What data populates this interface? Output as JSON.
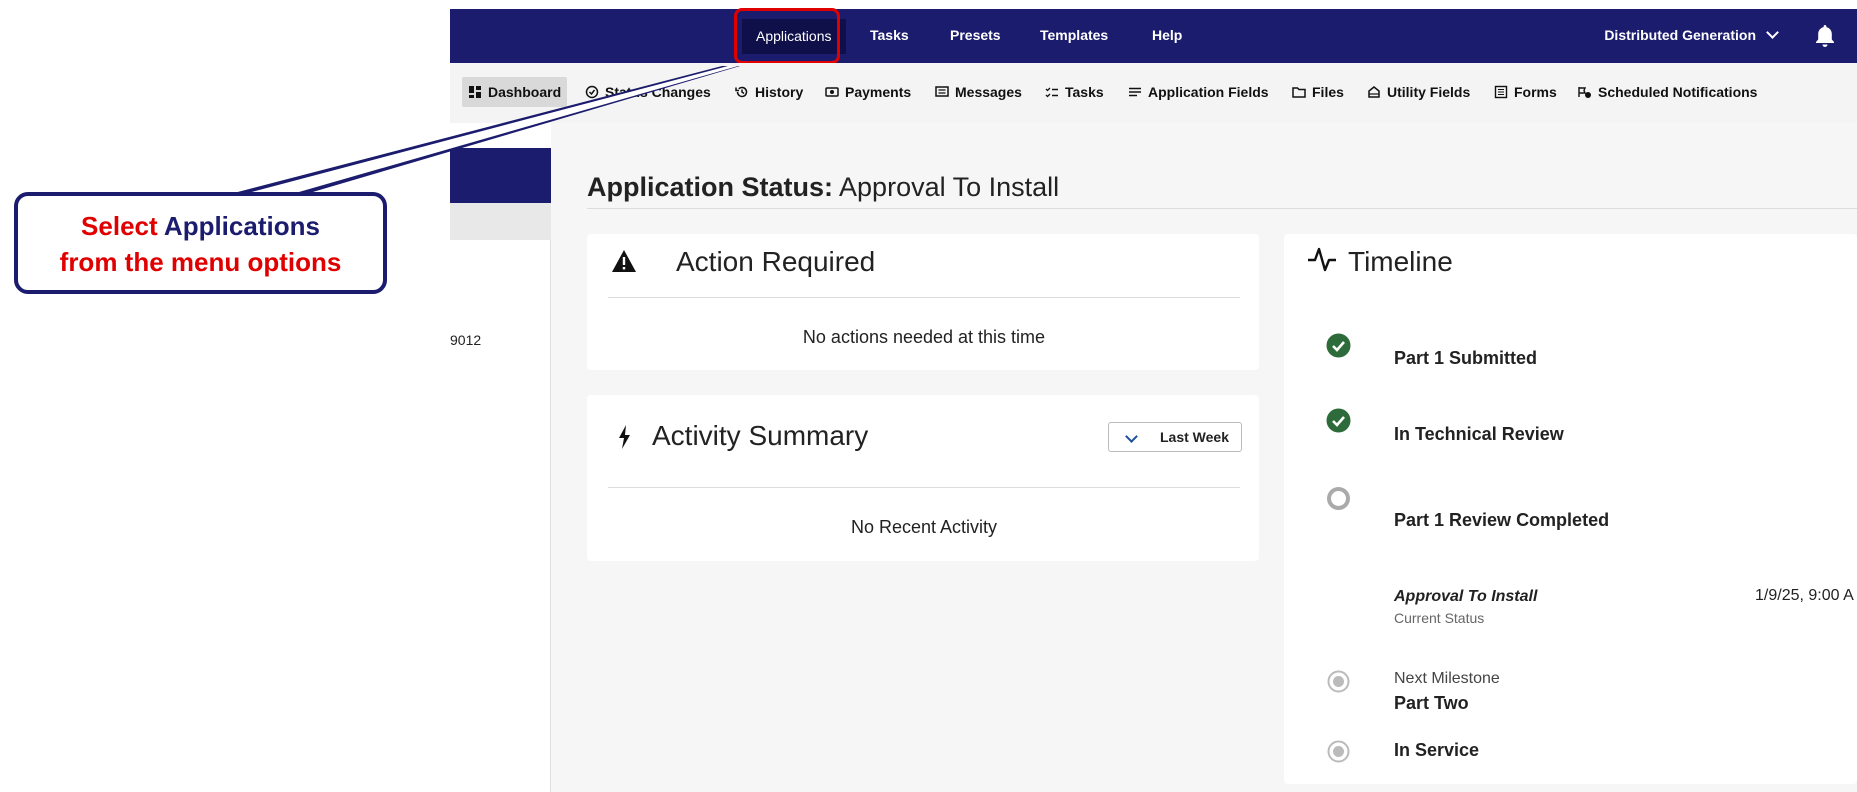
{
  "topnav": {
    "items": [
      "Applications",
      "Tasks",
      "Presets",
      "Templates",
      "Help"
    ],
    "active": "Applications",
    "org_selector": "Distributed Generation"
  },
  "subnav": {
    "items": [
      "Dashboard",
      "Status Changes",
      "History",
      "Payments",
      "Messages",
      "Tasks",
      "Application Fields",
      "Files",
      "Utility Fields",
      "Forms",
      "Scheduled Notifications"
    ],
    "active": "Dashboard"
  },
  "sidebar": {
    "partial_number": "9012"
  },
  "page": {
    "status_label": "Application Status:",
    "status_value": "Approval To Install"
  },
  "action_required": {
    "title": "Action Required",
    "message": "No actions needed at this time"
  },
  "activity_summary": {
    "title": "Activity Summary",
    "range_selected": "Last Week",
    "message": "No Recent Activity"
  },
  "timeline": {
    "title": "Timeline",
    "items": [
      {
        "label": "Part 1 Submitted",
        "state": "done"
      },
      {
        "label": "In Technical Review",
        "state": "done"
      },
      {
        "label": "Part 1 Review Completed",
        "state": "pending"
      },
      {
        "label": "Approval To Install",
        "sublabel": "Current Status",
        "date": "1/9/25, 9:00 A",
        "state": "current"
      },
      {
        "label": "Part Two",
        "prefix": "Next Milestone",
        "state": "future"
      },
      {
        "label": "In Service",
        "state": "future"
      }
    ]
  },
  "callout": {
    "word1": "Select",
    "word2": "Applications",
    "line2": "from the menu options"
  },
  "colors": {
    "navy": "#1c1c6e",
    "highlight_red": "#e00000",
    "done_green": "#2e6b3a"
  }
}
